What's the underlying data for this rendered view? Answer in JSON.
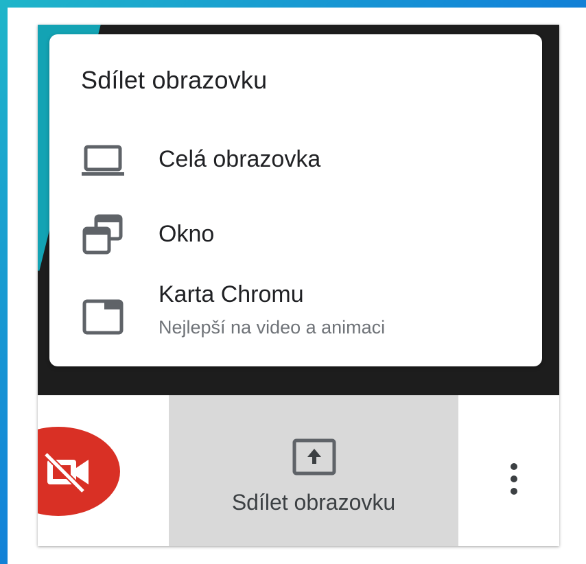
{
  "popup": {
    "title": "Sdílet obrazovku",
    "items": [
      {
        "label": "Celá obrazovka",
        "icon": "laptop-icon"
      },
      {
        "label": "Okno",
        "icon": "window-icon"
      },
      {
        "label": "Karta Chromu",
        "sublabel": "Nejlepší na video a animaci",
        "icon": "browser-tab-icon"
      }
    ]
  },
  "toolbar": {
    "camera_icon": "camera-off-icon",
    "share_label": "Sdílet obrazovku",
    "share_icon": "present-screen-icon",
    "more_icon": "more-vert-icon"
  },
  "colors": {
    "camera_off": "#d93025",
    "share_button_bg": "#d9d9d9",
    "video_bg": "#1d1d1d",
    "accent_teal": "#13a3b4",
    "icon_gray": "#5f6368"
  }
}
